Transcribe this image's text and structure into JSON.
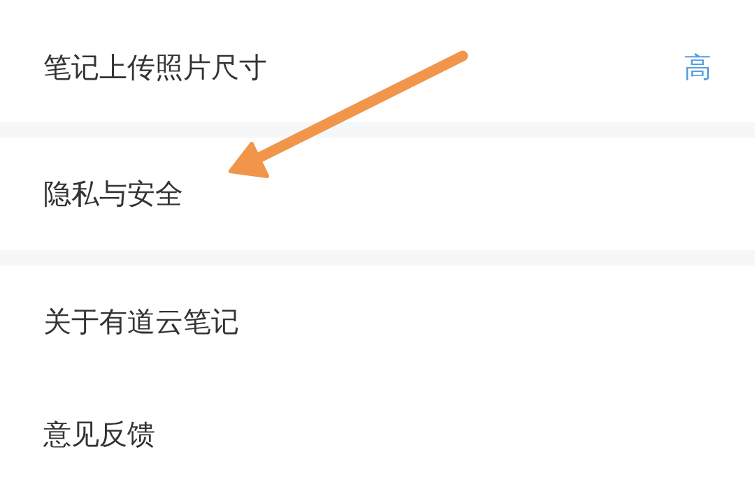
{
  "sections": [
    {
      "items": [
        {
          "label": "笔记上传照片尺寸",
          "value": "高"
        }
      ]
    },
    {
      "items": [
        {
          "label": "隐私与安全"
        }
      ]
    },
    {
      "items": [
        {
          "label": "关于有道云笔记"
        },
        {
          "label": "意见反馈"
        }
      ]
    }
  ]
}
